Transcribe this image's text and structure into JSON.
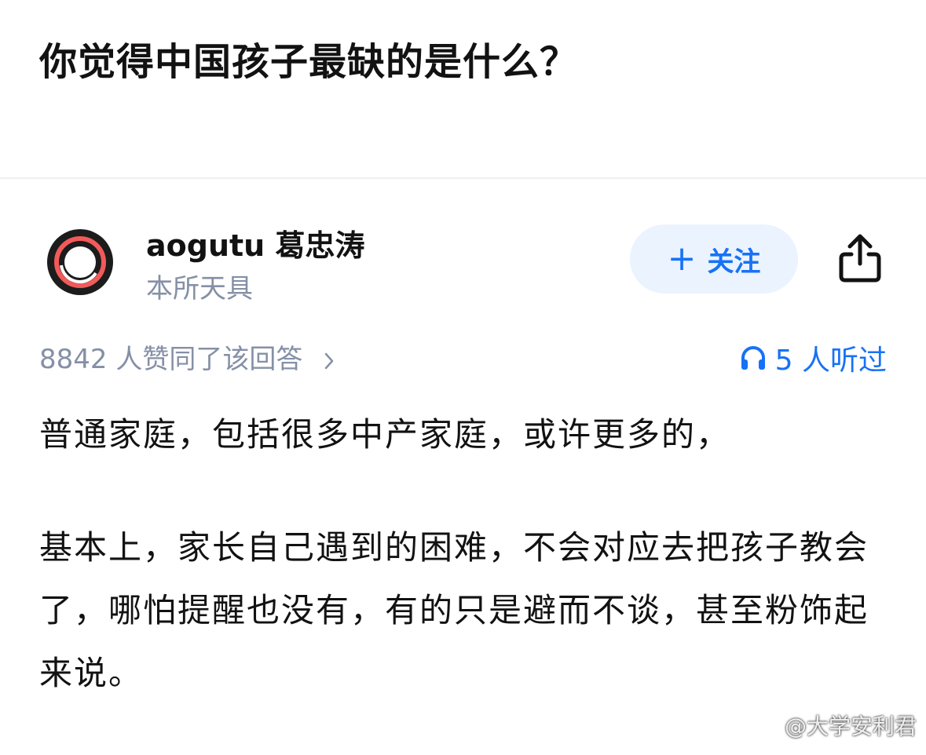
{
  "question": {
    "title": "你觉得中国孩子最缺的是什么？"
  },
  "author": {
    "name": "aogutu 葛忠涛",
    "bio": "本所天具",
    "avatar_icon": "ring-avatar-icon"
  },
  "follow_button": {
    "icon": "plus-icon",
    "plus_glyph": "+",
    "label": "关注"
  },
  "share": {
    "icon": "share-icon"
  },
  "meta": {
    "upvote_text": "8842 人赞同了该回答",
    "listened_text": "5 人听过",
    "listened_icon": "headphone-icon"
  },
  "answer": {
    "paragraphs": [
      "普通家庭，包括很多中产家庭，或许更多的，",
      "基本上，家长自己遇到的困难，不会对应去把孩子教会了，哪怕提醒也没有，有的只是避而不谈，甚至粉饰起来说。"
    ]
  },
  "watermark": {
    "text": "@大学安利君",
    "icon": "weibo-logo-icon"
  },
  "colors": {
    "accent_blue": "#1772f6",
    "follow_bg": "#ebf3ff",
    "secondary_text": "#8590a6",
    "primary_text": "#121212",
    "avatar_ring_red": "#f25a5a"
  }
}
